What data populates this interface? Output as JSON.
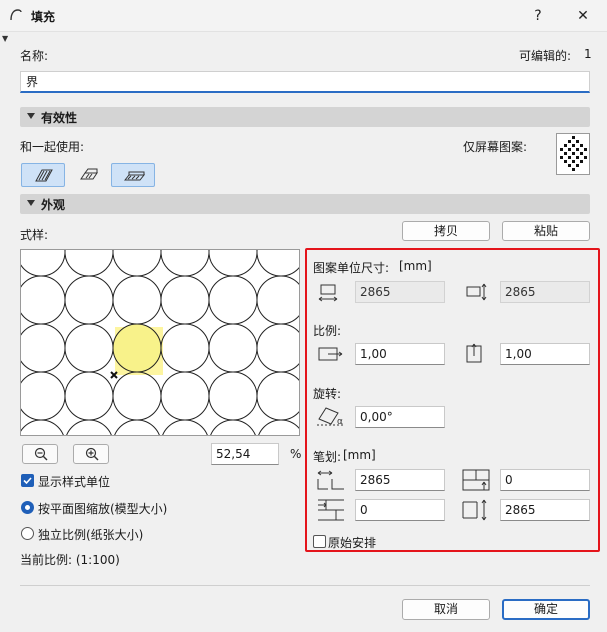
{
  "window": {
    "title": "填充",
    "help_label": "?",
    "close_label": "✕"
  },
  "name_field": {
    "label": "名称:",
    "value": "界"
  },
  "editable": {
    "label": "可编辑的:",
    "count": "1"
  },
  "validity_section": {
    "title": "有效性",
    "use_with_label": "和一起使用:",
    "screen_only_label": "仅屏幕图案:"
  },
  "appearance_section": {
    "title": "外观",
    "style_label": "式样:",
    "copy_label": "拷贝",
    "paste_label": "粘贴"
  },
  "zoom": {
    "value": "52,54",
    "unit": "%"
  },
  "options": {
    "show_unit_label": "显示样式单位",
    "show_unit_checked": true,
    "scale_model_label": "按平面图缩放(模型大小)",
    "scale_paper_label": "独立比例(纸张大小)",
    "selected_scale": "model",
    "current_scale": "当前比例: (1:100)"
  },
  "params": {
    "unit_size_label": "图案单位尺寸:",
    "unit_size_unit": "[mm]",
    "width": "2865",
    "height": "2865",
    "ratio_label": "比例:",
    "ratio_x": "1,00",
    "ratio_y": "1,00",
    "rotation_label": "旋转:",
    "rotation": "0,00°",
    "stroke_label": "笔划:",
    "stroke_unit": "[mm]",
    "stroke_1": "2865",
    "stroke_2": "0",
    "stroke_3": "0",
    "stroke_4": "2865",
    "original_label": "原始安排",
    "original_checked": false
  },
  "footer": {
    "cancel_label": "取消",
    "ok_label": "确定"
  },
  "colors": {
    "accent": "#2a6cc4",
    "highlight": "#e4141b",
    "pattern_highlight": "#fdf5a0"
  }
}
